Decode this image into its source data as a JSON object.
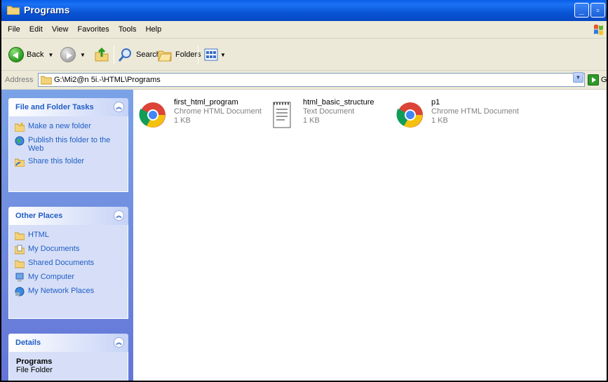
{
  "window": {
    "title": "Programs"
  },
  "menu": [
    "File",
    "Edit",
    "View",
    "Favorites",
    "Tools",
    "Help"
  ],
  "toolbar": {
    "back_label": "Back",
    "search_label": "Search",
    "folders_label": "Folders"
  },
  "address": {
    "label": "Address",
    "path": "G:\\Mi2@n 5i.-\\HTML\\Programs",
    "go_label": "Go"
  },
  "tasks": {
    "file_folder": {
      "title": "File and Folder Tasks",
      "items": [
        "Make a new folder",
        "Publish this folder to the Web",
        "Share this folder"
      ]
    },
    "other_places": {
      "title": "Other Places",
      "items": [
        "HTML",
        "My Documents",
        "Shared Documents",
        "My Computer",
        "My Network Places"
      ]
    },
    "details": {
      "title": "Details",
      "name": "Programs",
      "type": "File Folder"
    }
  },
  "files": [
    {
      "name": "first_html_program",
      "type": "Chrome HTML Document",
      "size": "1 KB",
      "icon": "chrome-icon"
    },
    {
      "name": "html_basic_structure",
      "type": "Text Document",
      "size": "1 KB",
      "icon": "notepad-icon"
    },
    {
      "name": "p1",
      "type": "Chrome HTML Document",
      "size": "1 KB",
      "icon": "chrome-icon"
    }
  ],
  "colors": {
    "titlebar": "#0a5ee6",
    "taskpane": "#7ba2e7",
    "link": "#215dc6"
  }
}
